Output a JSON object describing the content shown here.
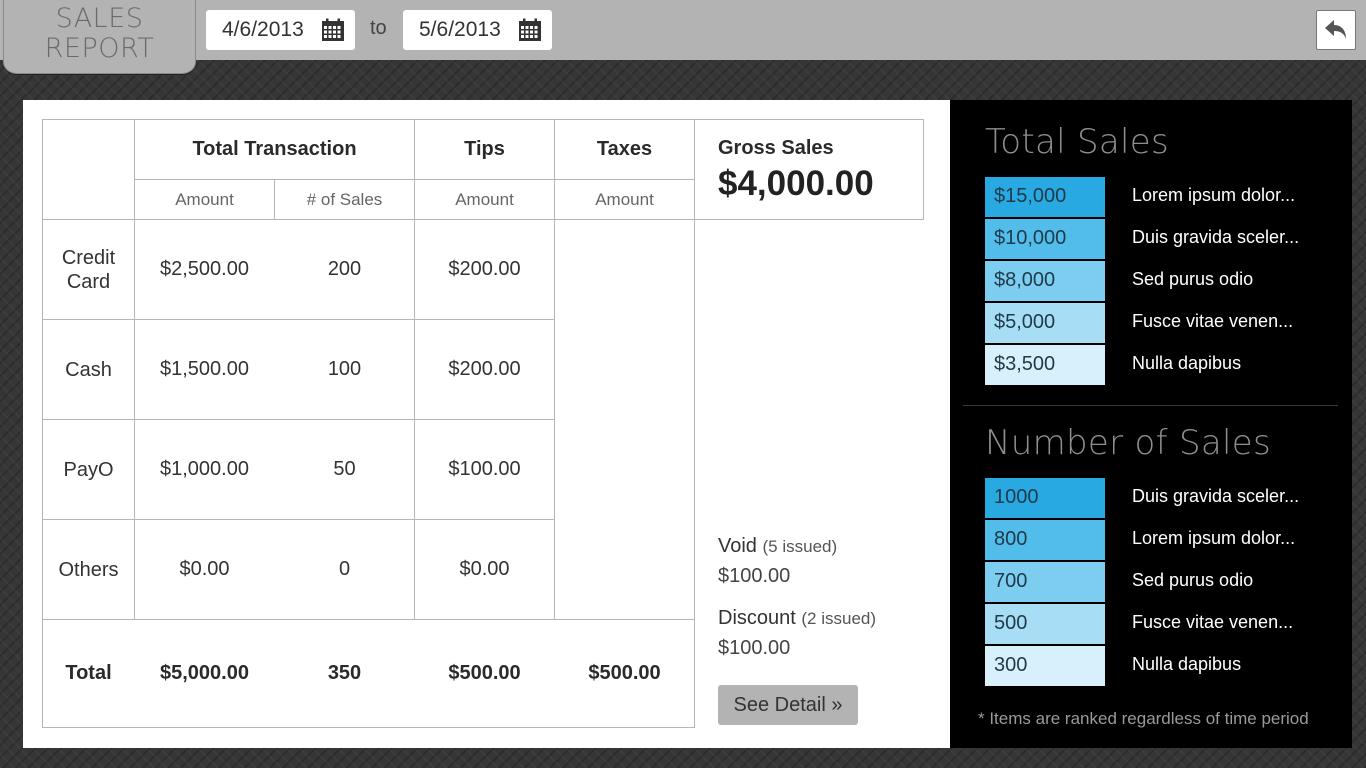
{
  "header": {
    "logo_line1": "SALES",
    "logo_line2": "REPORT",
    "start_date": "4/6/2013",
    "to_label": "to",
    "end_date": "5/6/2013",
    "back_icon": "undo-arrow-icon",
    "calendar_icon": "calendar-icon"
  },
  "table": {
    "group_headers": {
      "total_transaction": "Total Transaction",
      "tips": "Tips",
      "taxes": "Taxes"
    },
    "sub_headers": {
      "amount": "Amount",
      "num_sales": "# of Sales",
      "tips_amount": "Amount",
      "taxes_amount": "Amount"
    },
    "rows": [
      {
        "label": "Credit Card",
        "amount": "$2,500.00",
        "num_sales": "200",
        "tips": "$200.00"
      },
      {
        "label": "Cash",
        "amount": "$1,500.00",
        "num_sales": "100",
        "tips": "$200.00"
      },
      {
        "label": "PayO",
        "amount": "$1,000.00",
        "num_sales": "50",
        "tips": "$100.00"
      },
      {
        "label": "Others",
        "amount": "$0.00",
        "num_sales": "0",
        "tips": "$0.00"
      }
    ],
    "total": {
      "label": "Total",
      "amount": "$5,000.00",
      "num_sales": "350",
      "tips": "$500.00",
      "taxes": "$500.00"
    }
  },
  "gross": {
    "label": "Gross Sales",
    "value": "$4,000.00"
  },
  "adjustments": {
    "void_label": "Void",
    "void_issued": "(5 issued)",
    "void_value": "$100.00",
    "discount_label": "Discount",
    "discount_issued": "(2 issued)",
    "discount_value": "$100.00",
    "see_detail_label": "See Detail »"
  },
  "sidebar": {
    "total_sales": {
      "title": "Total Sales",
      "items": [
        {
          "value": "$15,000",
          "label": "Lorem ipsum dolor..."
        },
        {
          "value": "$10,000",
          "label": "Duis gravida sceler..."
        },
        {
          "value": "$8,000",
          "label": "Sed purus odio"
        },
        {
          "value": "$5,000",
          "label": "Fusce vitae venen..."
        },
        {
          "value": "$3,500",
          "label": "Nulla dapibus"
        }
      ]
    },
    "number_of_sales": {
      "title": "Number of Sales",
      "items": [
        {
          "value": "1000",
          "label": "Duis gravida sceler..."
        },
        {
          "value": "800",
          "label": "Lorem ipsum dolor..."
        },
        {
          "value": "700",
          "label": "Sed purus odio"
        },
        {
          "value": "500",
          "label": "Fusce vitae venen..."
        },
        {
          "value": "300",
          "label": "Nulla dapibus"
        }
      ]
    },
    "rank_colors": [
      "#29a9e1",
      "#52bcea",
      "#7dcdf0",
      "#a8def5",
      "#d7f0fb"
    ],
    "footnote": "* Items are ranked regardless of time period"
  }
}
